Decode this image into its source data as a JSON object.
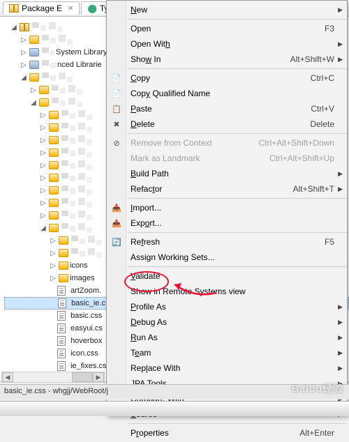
{
  "tabs": [
    {
      "label": "Package E",
      "icon": "package"
    },
    {
      "label": "Type",
      "icon": "type"
    }
  ],
  "tree": {
    "lib1": "System Library",
    "lib2": "nced Librarie",
    "folders": {
      "icons": "icons",
      "images": "images"
    },
    "files": {
      "artZoom": "artZoom.",
      "basic_ie": "basic_ie.c",
      "basic": "basic.css",
      "easyui": "easyui.cs",
      "hoverbox": "hoverbox",
      "icon": "icon.css",
      "ie_fixes": "ie_fixes.cs"
    }
  },
  "menu": {
    "new": "New",
    "open": "Open",
    "open_sc": "F3",
    "open_with": "Open With",
    "show_in": "Show In",
    "show_in_sc": "Alt+Shift+W",
    "copy": "Copy",
    "copy_sc": "Ctrl+C",
    "copy_qn": "Copy Qualified Name",
    "paste": "Paste",
    "paste_sc": "Ctrl+V",
    "delete": "Delete",
    "delete_sc": "Delete",
    "remove_ctx": "Remove from Context",
    "remove_ctx_sc": "Ctrl+Alt+Shift+Down",
    "mark_lm": "Mark as Landmark",
    "mark_lm_sc": "Ctrl+Alt+Shift+Up",
    "build_path": "Build Path",
    "refactor": "Refactor",
    "refactor_sc": "Alt+Shift+T",
    "import": "Import...",
    "export": "Export...",
    "refresh": "Refresh",
    "refresh_sc": "F5",
    "assign_ws": "Assign Working Sets...",
    "validate": "Validate",
    "show_remote": "Show in Remote Systems view",
    "profile_as": "Profile As",
    "debug_as": "Debug As",
    "run_as": "Run As",
    "team": "Team",
    "replace_with": "Replace With",
    "jpa_tools": "JPA Tools",
    "compare_with": "Compare With",
    "source": "Source",
    "properties": "Properties",
    "properties_sc": "Alt+Enter"
  },
  "status": "basic_ie.css - whgjj/WebRoot/j",
  "watermark": "Baidu经验"
}
